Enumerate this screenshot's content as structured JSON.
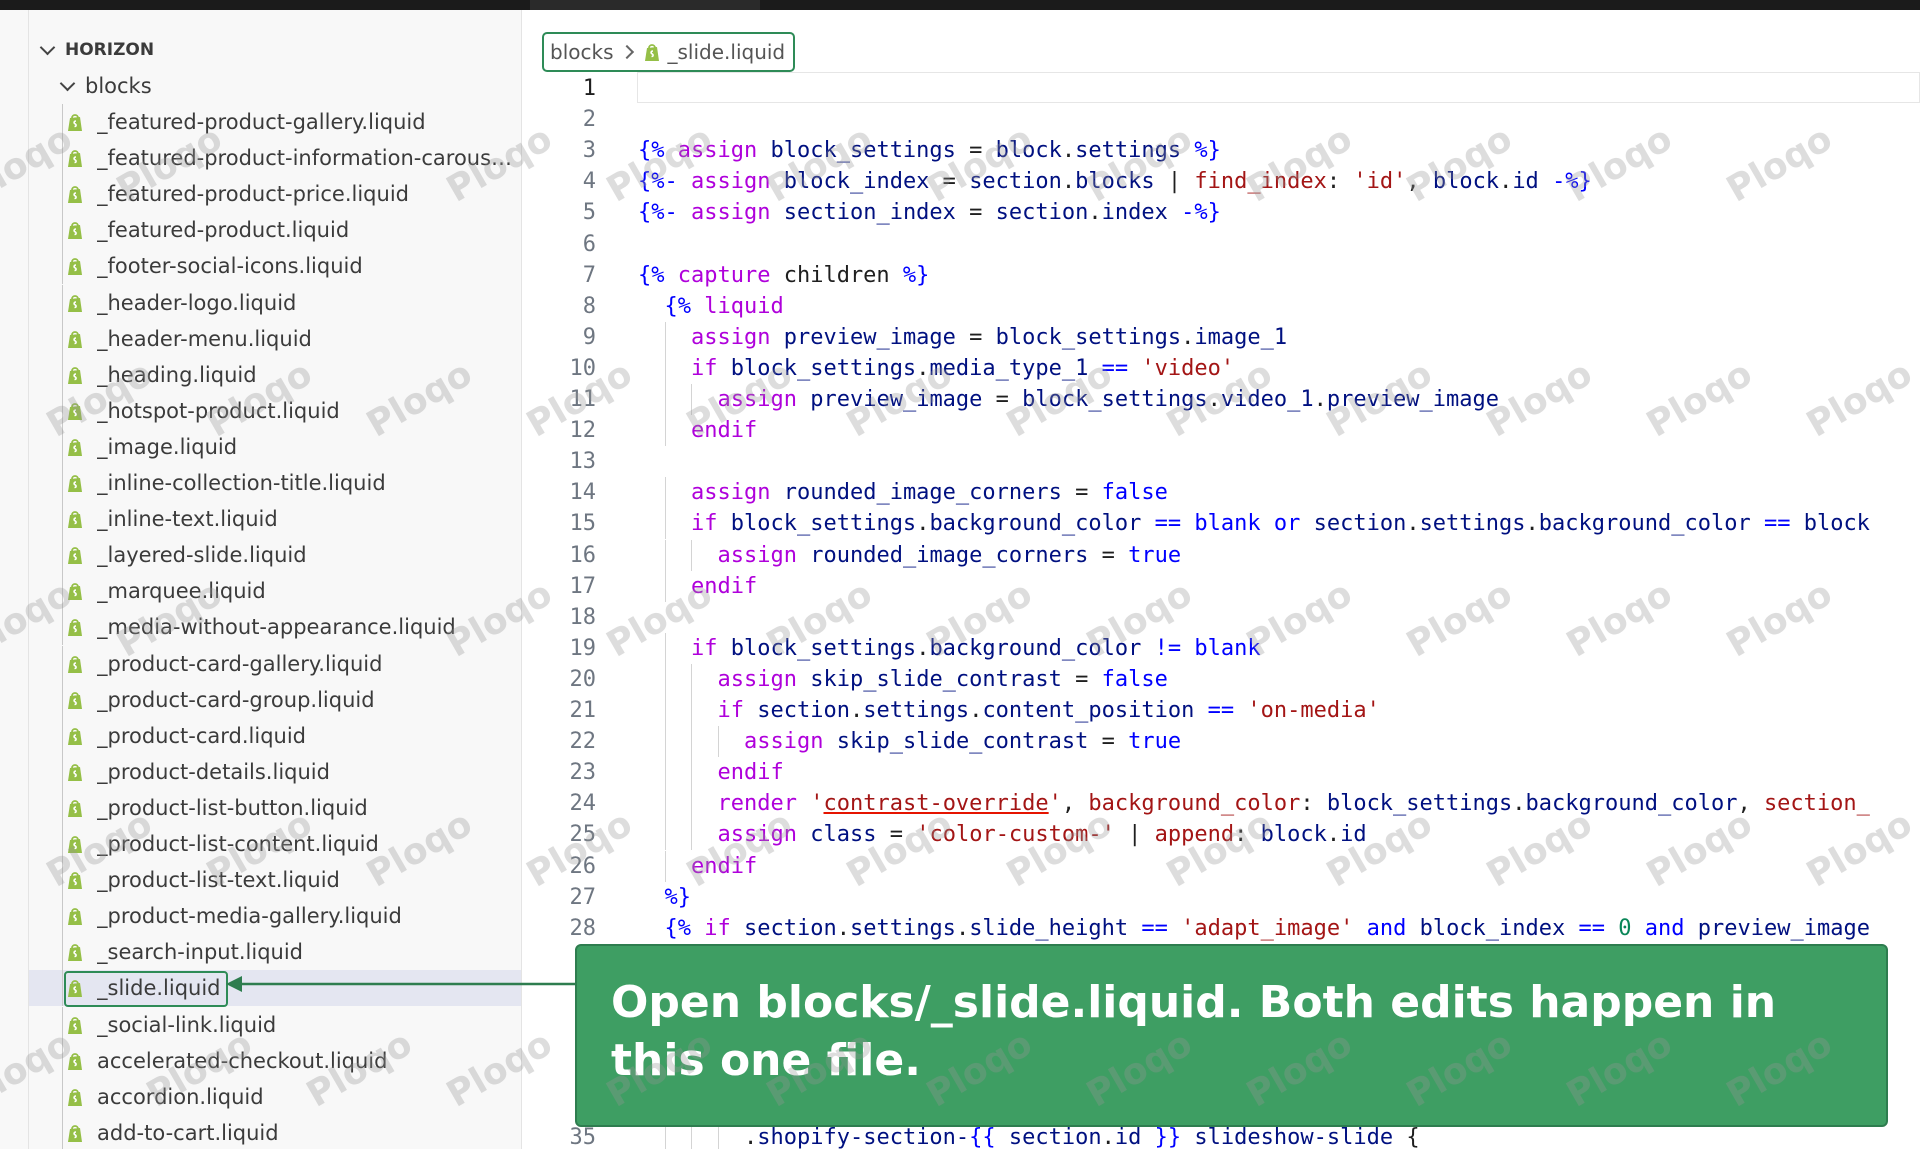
{
  "sidebar": {
    "root_label": "HORIZON",
    "folder_label": "blocks",
    "files": [
      "_featured-product-gallery.liquid",
      "_featured-product-information-carousel.li...",
      "_featured-product-price.liquid",
      "_featured-product.liquid",
      "_footer-social-icons.liquid",
      "_header-logo.liquid",
      "_header-menu.liquid",
      "_heading.liquid",
      "_hotspot-product.liquid",
      "_image.liquid",
      "_inline-collection-title.liquid",
      "_inline-text.liquid",
      "_layered-slide.liquid",
      "_marquee.liquid",
      "_media-without-appearance.liquid",
      "_product-card-gallery.liquid",
      "_product-card-group.liquid",
      "_product-card.liquid",
      "_product-details.liquid",
      "_product-list-button.liquid",
      "_product-list-content.liquid",
      "_product-list-text.liquid",
      "_product-media-gallery.liquid",
      "_search-input.liquid",
      "_slide.liquid",
      "_social-link.liquid",
      "accelerated-checkout.liquid",
      "accordion.liquid",
      "add-to-cart.liquid"
    ],
    "selected_index": 24
  },
  "breadcrumb": {
    "folder": "blocks",
    "file": "_slide.liquid"
  },
  "editor": {
    "lines": [
      {
        "n": "1",
        "indent": 0,
        "tokens": []
      },
      {
        "n": "2",
        "indent": 0,
        "tokens": []
      },
      {
        "n": "3",
        "indent": 0,
        "tokens": [
          [
            "tag",
            "{%"
          ],
          [
            "plain",
            " "
          ],
          [
            "kw",
            "assign"
          ],
          [
            "plain",
            " "
          ],
          [
            "var",
            "block_settings"
          ],
          [
            "plain",
            " = "
          ],
          [
            "var",
            "block"
          ],
          [
            "plain",
            "."
          ],
          [
            "var",
            "settings"
          ],
          [
            "plain",
            " "
          ],
          [
            "tag",
            "%}"
          ]
        ]
      },
      {
        "n": "4",
        "indent": 0,
        "tokens": [
          [
            "tag",
            "{%-"
          ],
          [
            "plain",
            " "
          ],
          [
            "kw",
            "assign"
          ],
          [
            "plain",
            " "
          ],
          [
            "var",
            "block_index"
          ],
          [
            "plain",
            " = "
          ],
          [
            "var",
            "section"
          ],
          [
            "plain",
            "."
          ],
          [
            "var",
            "blocks"
          ],
          [
            "plain",
            " | "
          ],
          [
            "kw2",
            "find_index"
          ],
          [
            "plain",
            ": "
          ],
          [
            "str",
            "'id'"
          ],
          [
            "plain",
            ", "
          ],
          [
            "var",
            "block"
          ],
          [
            "plain",
            "."
          ],
          [
            "var",
            "id"
          ],
          [
            "plain",
            " "
          ],
          [
            "tag",
            "-%}"
          ]
        ]
      },
      {
        "n": "5",
        "indent": 0,
        "tokens": [
          [
            "tag",
            "{%-"
          ],
          [
            "plain",
            " "
          ],
          [
            "kw",
            "assign"
          ],
          [
            "plain",
            " "
          ],
          [
            "var",
            "section_index"
          ],
          [
            "plain",
            " = "
          ],
          [
            "var",
            "section"
          ],
          [
            "plain",
            "."
          ],
          [
            "var",
            "index"
          ],
          [
            "plain",
            " "
          ],
          [
            "tag",
            "-%}"
          ]
        ]
      },
      {
        "n": "6",
        "indent": 0,
        "tokens": []
      },
      {
        "n": "7",
        "indent": 0,
        "tokens": [
          [
            "tag",
            "{%"
          ],
          [
            "plain",
            " "
          ],
          [
            "kw",
            "capture"
          ],
          [
            "plain",
            " children "
          ],
          [
            "tag",
            "%}"
          ]
        ]
      },
      {
        "n": "8",
        "indent": 1,
        "tokens": [
          [
            "tag",
            "{%"
          ],
          [
            "plain",
            " "
          ],
          [
            "kw",
            "liquid"
          ]
        ]
      },
      {
        "n": "9",
        "indent": 2,
        "tokens": [
          [
            "kw",
            "assign"
          ],
          [
            "plain",
            " "
          ],
          [
            "var",
            "preview_image"
          ],
          [
            "plain",
            " = "
          ],
          [
            "var",
            "block_settings"
          ],
          [
            "plain",
            "."
          ],
          [
            "var",
            "image_1"
          ]
        ]
      },
      {
        "n": "10",
        "indent": 2,
        "tokens": [
          [
            "kw",
            "if"
          ],
          [
            "plain",
            " "
          ],
          [
            "var",
            "block_settings"
          ],
          [
            "plain",
            "."
          ],
          [
            "var",
            "media_type_1"
          ],
          [
            "plain",
            " "
          ],
          [
            "bool",
            "=="
          ],
          [
            "plain",
            " "
          ],
          [
            "str",
            "'video'"
          ]
        ]
      },
      {
        "n": "11",
        "indent": 3,
        "tokens": [
          [
            "kw",
            "assign"
          ],
          [
            "plain",
            " "
          ],
          [
            "var",
            "preview_image"
          ],
          [
            "plain",
            " = "
          ],
          [
            "var",
            "block_settings"
          ],
          [
            "plain",
            "."
          ],
          [
            "var",
            "video_1"
          ],
          [
            "plain",
            "."
          ],
          [
            "var",
            "preview_image"
          ]
        ]
      },
      {
        "n": "12",
        "indent": 2,
        "tokens": [
          [
            "kw",
            "endif"
          ]
        ]
      },
      {
        "n": "13",
        "indent": 0,
        "tokens": []
      },
      {
        "n": "14",
        "indent": 2,
        "tokens": [
          [
            "kw",
            "assign"
          ],
          [
            "plain",
            " "
          ],
          [
            "var",
            "rounded_image_corners"
          ],
          [
            "plain",
            " = "
          ],
          [
            "bool",
            "false"
          ]
        ]
      },
      {
        "n": "15",
        "indent": 2,
        "tokens": [
          [
            "kw",
            "if"
          ],
          [
            "plain",
            " "
          ],
          [
            "var",
            "block_settings"
          ],
          [
            "plain",
            "."
          ],
          [
            "var",
            "background_color"
          ],
          [
            "plain",
            " "
          ],
          [
            "bool",
            "=="
          ],
          [
            "plain",
            " "
          ],
          [
            "bool",
            "blank"
          ],
          [
            "plain",
            " "
          ],
          [
            "bool",
            "or"
          ],
          [
            "plain",
            " "
          ],
          [
            "var",
            "section"
          ],
          [
            "plain",
            "."
          ],
          [
            "var",
            "settings"
          ],
          [
            "plain",
            "."
          ],
          [
            "var",
            "background_color"
          ],
          [
            "plain",
            " "
          ],
          [
            "bool",
            "=="
          ],
          [
            "plain",
            " "
          ],
          [
            "var",
            "block"
          ]
        ]
      },
      {
        "n": "16",
        "indent": 3,
        "tokens": [
          [
            "kw",
            "assign"
          ],
          [
            "plain",
            " "
          ],
          [
            "var",
            "rounded_image_corners"
          ],
          [
            "plain",
            " = "
          ],
          [
            "bool",
            "true"
          ]
        ]
      },
      {
        "n": "17",
        "indent": 2,
        "tokens": [
          [
            "kw",
            "endif"
          ]
        ]
      },
      {
        "n": "18",
        "indent": 0,
        "tokens": []
      },
      {
        "n": "19",
        "indent": 2,
        "tokens": [
          [
            "kw",
            "if"
          ],
          [
            "plain",
            " "
          ],
          [
            "var",
            "block_settings"
          ],
          [
            "plain",
            "."
          ],
          [
            "var",
            "background_color"
          ],
          [
            "plain",
            " "
          ],
          [
            "bool",
            "!="
          ],
          [
            "plain",
            " "
          ],
          [
            "bool",
            "blank"
          ]
        ]
      },
      {
        "n": "20",
        "indent": 3,
        "tokens": [
          [
            "kw",
            "assign"
          ],
          [
            "plain",
            " "
          ],
          [
            "var",
            "skip_slide_contrast"
          ],
          [
            "plain",
            " = "
          ],
          [
            "bool",
            "false"
          ]
        ]
      },
      {
        "n": "21",
        "indent": 3,
        "tokens": [
          [
            "kw",
            "if"
          ],
          [
            "plain",
            " "
          ],
          [
            "var",
            "section"
          ],
          [
            "plain",
            "."
          ],
          [
            "var",
            "settings"
          ],
          [
            "plain",
            "."
          ],
          [
            "var",
            "content_position"
          ],
          [
            "plain",
            " "
          ],
          [
            "bool",
            "=="
          ],
          [
            "plain",
            " "
          ],
          [
            "str",
            "'on-media'"
          ]
        ]
      },
      {
        "n": "22",
        "indent": 4,
        "tokens": [
          [
            "kw",
            "assign"
          ],
          [
            "plain",
            " "
          ],
          [
            "var",
            "skip_slide_contrast"
          ],
          [
            "plain",
            " = "
          ],
          [
            "bool",
            "true"
          ]
        ]
      },
      {
        "n": "23",
        "indent": 3,
        "tokens": [
          [
            "kw",
            "endif"
          ]
        ]
      },
      {
        "n": "24",
        "indent": 3,
        "tokens": [
          [
            "kw",
            "render"
          ],
          [
            "plain",
            " "
          ],
          [
            "str",
            "'"
          ],
          [
            "squig",
            "contrast-override"
          ],
          [
            "str",
            "'"
          ],
          [
            "plain",
            ", "
          ],
          [
            "str",
            "background_color"
          ],
          [
            "plain",
            ": "
          ],
          [
            "var",
            "block_settings"
          ],
          [
            "plain",
            "."
          ],
          [
            "var",
            "background_color"
          ],
          [
            "plain",
            ", "
          ],
          [
            "str",
            "section_"
          ]
        ]
      },
      {
        "n": "25",
        "indent": 3,
        "tokens": [
          [
            "kw",
            "assign"
          ],
          [
            "plain",
            " "
          ],
          [
            "var",
            "class"
          ],
          [
            "plain",
            " = "
          ],
          [
            "str",
            "'color-custom-'"
          ],
          [
            "plain",
            " | "
          ],
          [
            "kw2",
            "append"
          ],
          [
            "plain",
            ": "
          ],
          [
            "var",
            "block"
          ],
          [
            "plain",
            "."
          ],
          [
            "var",
            "id"
          ]
        ]
      },
      {
        "n": "26",
        "indent": 2,
        "tokens": [
          [
            "kw",
            "endif"
          ]
        ]
      },
      {
        "n": "27",
        "indent": 1,
        "tokens": [
          [
            "tag",
            "%}"
          ]
        ]
      },
      {
        "n": "28",
        "indent": 1,
        "tokens": [
          [
            "tag",
            "{%"
          ],
          [
            "plain",
            " "
          ],
          [
            "kw",
            "if"
          ],
          [
            "plain",
            " "
          ],
          [
            "var",
            "section"
          ],
          [
            "plain",
            "."
          ],
          [
            "var",
            "settings"
          ],
          [
            "plain",
            "."
          ],
          [
            "var",
            "slide_height"
          ],
          [
            "plain",
            " "
          ],
          [
            "bool",
            "=="
          ],
          [
            "plain",
            " "
          ],
          [
            "str",
            "'adapt_image'"
          ],
          [
            "plain",
            " "
          ],
          [
            "bool",
            "and"
          ],
          [
            "plain",
            " "
          ],
          [
            "var",
            "block_index"
          ],
          [
            "plain",
            " "
          ],
          [
            "bool",
            "=="
          ],
          [
            "plain",
            " "
          ],
          [
            "num",
            "0"
          ],
          [
            "plain",
            " "
          ],
          [
            "bool",
            "and"
          ],
          [
            "plain",
            " "
          ],
          [
            "var",
            "preview_image"
          ]
        ]
      },
      {
        "n": "35",
        "indent": 4,
        "tokens": [
          [
            "plain",
            "."
          ],
          [
            "var",
            "shopify-section-"
          ],
          [
            "tag",
            "{{"
          ],
          [
            "plain",
            " "
          ],
          [
            "var",
            "section"
          ],
          [
            "plain",
            "."
          ],
          [
            "var",
            "id"
          ],
          [
            "plain",
            " "
          ],
          [
            "tag",
            "}}"
          ],
          [
            "plain",
            " "
          ],
          [
            "var",
            "slideshow-slide"
          ],
          [
            "plain",
            " {"
          ]
        ]
      }
    ]
  },
  "callout": {
    "text": "Open blocks/_slide.liquid. Both edits happen in this one file."
  },
  "watermark": {
    "text": "Ploqo"
  },
  "colors": {
    "accent_green": "#2e8b57",
    "callout_bg": "#3e9e63",
    "shopify_green": "#95bf47"
  }
}
